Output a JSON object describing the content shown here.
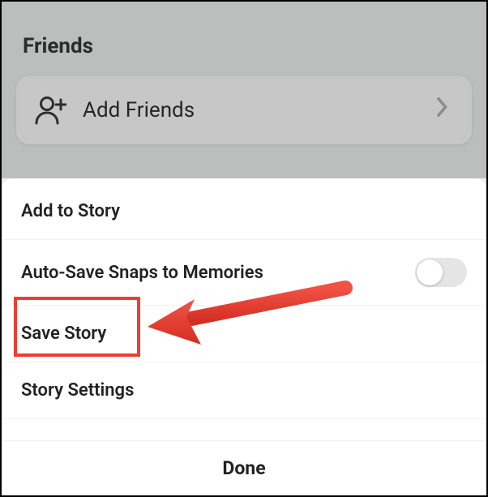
{
  "background": {
    "section_header": "Friends",
    "card": {
      "label": "Add Friends"
    }
  },
  "sheet": {
    "rows": [
      {
        "label": "Add to Story"
      },
      {
        "label": "Auto-Save Snaps to Memories"
      },
      {
        "label": "Save Story"
      },
      {
        "label": "Story Settings"
      }
    ],
    "done_label": "Done"
  },
  "annotation": {
    "highlight_color": "#ee3d32",
    "arrow_color": "#ee3d32"
  }
}
